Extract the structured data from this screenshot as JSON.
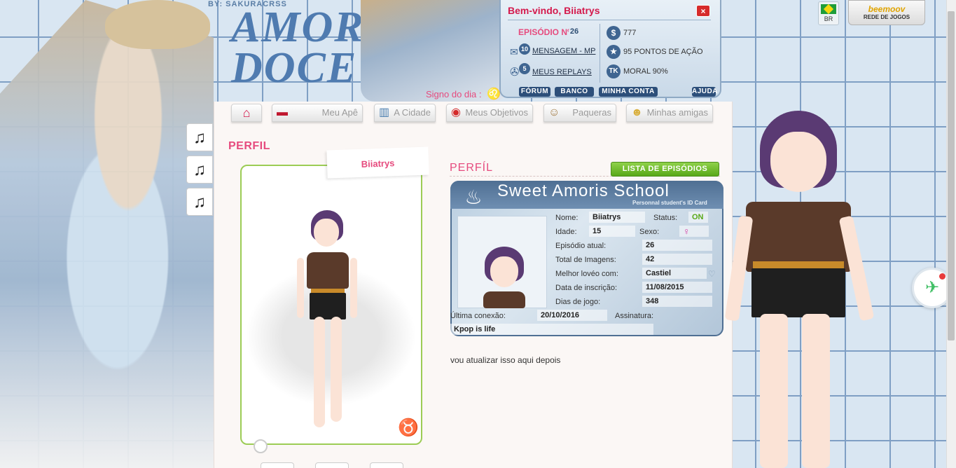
{
  "header": {
    "byline": "BY: SAKURACRSS",
    "logo_line1": "AMOR",
    "logo_line2": "DOCE",
    "sign_label": "Signo do dia :",
    "sign_icon": "♌"
  },
  "panel": {
    "welcome": "Bem-vindo, Biiatrys",
    "close": "×",
    "episode_label": "EPISÓDIO Nº",
    "episode_number": "26",
    "messages_count": "10",
    "messages_label": "MENSAGEM - MP",
    "replays_count": "5",
    "replays_label": "MEUS REPLAYS",
    "money": "777",
    "action_points": "95 PONTOS DE AÇÃO",
    "morale": "MORAL 90%",
    "buttons": [
      "FÓRUM",
      "BANCO",
      "MINHA CONTA",
      "AJUDA"
    ]
  },
  "top_right": {
    "lang": "BR",
    "network_brand": "beemoov",
    "network_label": "REDE DE JOGOS"
  },
  "music_icon": "♫",
  "nav": {
    "tabs": [
      {
        "label": "",
        "icon": "⌂"
      },
      {
        "label": "Meu Apê",
        "icon": "▬"
      },
      {
        "label": "A Cidade",
        "icon": "▥"
      },
      {
        "label": "Meus Objetivos",
        "icon": "◉"
      },
      {
        "label": "Paqueras",
        "icon": "☺"
      },
      {
        "label": "Minhas amigas",
        "icon": "☻"
      }
    ]
  },
  "page_title": "PERFIL",
  "avatar_card": {
    "name": "Biiatrys",
    "zodiac": "♉"
  },
  "profile": {
    "subtitle": "PERFÍL",
    "episodes_button": "LISTA DE EPISÓDIOS",
    "school_title": "Sweet Amoris School",
    "school_subtitle": "Personnal student's ID Card",
    "fields": {
      "name_label": "Nome:",
      "name_value": "Biiatrys",
      "status_label": "Status:",
      "status_value": "ON",
      "age_label": "Idade:",
      "age_value": "15",
      "sex_label": "Sexo:",
      "sex_value": "♀",
      "episode_label": "Episódio atual:",
      "episode_value": "26",
      "images_label": "Total de Imagens:",
      "images_value": "42",
      "love_label": "Melhor lovéo com:",
      "love_value": "Castiel",
      "love_icon": "♡",
      "signup_label": "Data de inscrição:",
      "signup_value": "11/08/2015",
      "days_label": "Dias de jogo:",
      "days_value": "348",
      "last_label": "Última conexão:",
      "last_value": "20/10/2016",
      "signature_label": "Assinatura:",
      "signature_value": "Kpop is life"
    },
    "description": "vou atualizar isso aqui depois"
  },
  "share_icon": "✈",
  "colors": {
    "accent_pink": "#e64b7e",
    "panel_red": "#d4194c",
    "green": "#58a818",
    "navy": "#2d4f7a"
  }
}
